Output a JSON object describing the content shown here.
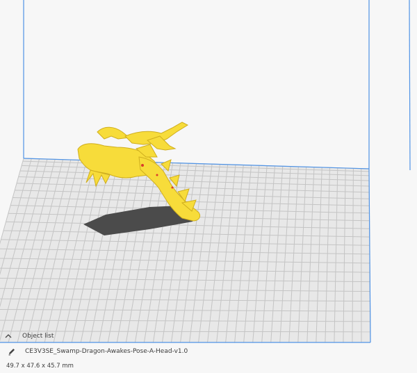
{
  "viewport": {
    "model_color": "#f5de3c",
    "model_outline": "#c9a817",
    "build_volume_color": "#4a8fe0",
    "grid_color": "#c8c8c8",
    "plate_color": "#e6e6e6",
    "shadow_color": "#4a4a4a"
  },
  "object_panel": {
    "header_icon": "chevron-up-icon",
    "header_label": "Object list",
    "item_icon": "pencil-icon",
    "object_name": "CE3V3SE_Swamp-Dragon-Awakes-Pose-A-Head-v1.0",
    "dimensions": "49.7 x 47.6 x 45.7 mm"
  }
}
